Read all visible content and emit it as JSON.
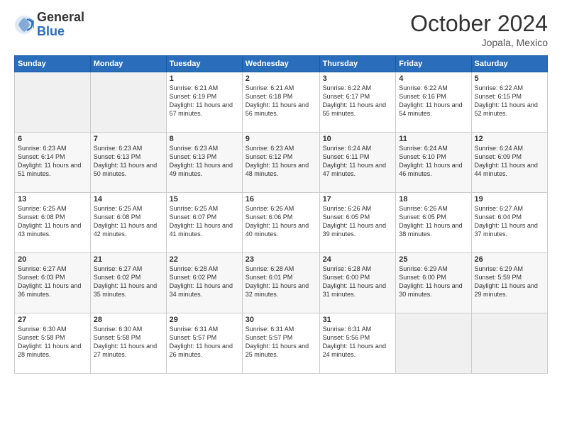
{
  "logo": {
    "general": "General",
    "blue": "Blue"
  },
  "title": "October 2024",
  "location": "Jopala, Mexico",
  "days_of_week": [
    "Sunday",
    "Monday",
    "Tuesday",
    "Wednesday",
    "Thursday",
    "Friday",
    "Saturday"
  ],
  "weeks": [
    [
      {
        "day": "",
        "info": ""
      },
      {
        "day": "",
        "info": ""
      },
      {
        "day": "1",
        "info": "Sunrise: 6:21 AM\nSunset: 6:19 PM\nDaylight: 11 hours and 57 minutes."
      },
      {
        "day": "2",
        "info": "Sunrise: 6:21 AM\nSunset: 6:18 PM\nDaylight: 11 hours and 56 minutes."
      },
      {
        "day": "3",
        "info": "Sunrise: 6:22 AM\nSunset: 6:17 PM\nDaylight: 11 hours and 55 minutes."
      },
      {
        "day": "4",
        "info": "Sunrise: 6:22 AM\nSunset: 6:16 PM\nDaylight: 11 hours and 54 minutes."
      },
      {
        "day": "5",
        "info": "Sunrise: 6:22 AM\nSunset: 6:15 PM\nDaylight: 11 hours and 52 minutes."
      }
    ],
    [
      {
        "day": "6",
        "info": "Sunrise: 6:23 AM\nSunset: 6:14 PM\nDaylight: 11 hours and 51 minutes."
      },
      {
        "day": "7",
        "info": "Sunrise: 6:23 AM\nSunset: 6:13 PM\nDaylight: 11 hours and 50 minutes."
      },
      {
        "day": "8",
        "info": "Sunrise: 6:23 AM\nSunset: 6:13 PM\nDaylight: 11 hours and 49 minutes."
      },
      {
        "day": "9",
        "info": "Sunrise: 6:23 AM\nSunset: 6:12 PM\nDaylight: 11 hours and 48 minutes."
      },
      {
        "day": "10",
        "info": "Sunrise: 6:24 AM\nSunset: 6:11 PM\nDaylight: 11 hours and 47 minutes."
      },
      {
        "day": "11",
        "info": "Sunrise: 6:24 AM\nSunset: 6:10 PM\nDaylight: 11 hours and 46 minutes."
      },
      {
        "day": "12",
        "info": "Sunrise: 6:24 AM\nSunset: 6:09 PM\nDaylight: 11 hours and 44 minutes."
      }
    ],
    [
      {
        "day": "13",
        "info": "Sunrise: 6:25 AM\nSunset: 6:08 PM\nDaylight: 11 hours and 43 minutes."
      },
      {
        "day": "14",
        "info": "Sunrise: 6:25 AM\nSunset: 6:08 PM\nDaylight: 11 hours and 42 minutes."
      },
      {
        "day": "15",
        "info": "Sunrise: 6:25 AM\nSunset: 6:07 PM\nDaylight: 11 hours and 41 minutes."
      },
      {
        "day": "16",
        "info": "Sunrise: 6:26 AM\nSunset: 6:06 PM\nDaylight: 11 hours and 40 minutes."
      },
      {
        "day": "17",
        "info": "Sunrise: 6:26 AM\nSunset: 6:05 PM\nDaylight: 11 hours and 39 minutes."
      },
      {
        "day": "18",
        "info": "Sunrise: 6:26 AM\nSunset: 6:05 PM\nDaylight: 11 hours and 38 minutes."
      },
      {
        "day": "19",
        "info": "Sunrise: 6:27 AM\nSunset: 6:04 PM\nDaylight: 11 hours and 37 minutes."
      }
    ],
    [
      {
        "day": "20",
        "info": "Sunrise: 6:27 AM\nSunset: 6:03 PM\nDaylight: 11 hours and 36 minutes."
      },
      {
        "day": "21",
        "info": "Sunrise: 6:27 AM\nSunset: 6:02 PM\nDaylight: 11 hours and 35 minutes."
      },
      {
        "day": "22",
        "info": "Sunrise: 6:28 AM\nSunset: 6:02 PM\nDaylight: 11 hours and 34 minutes."
      },
      {
        "day": "23",
        "info": "Sunrise: 6:28 AM\nSunset: 6:01 PM\nDaylight: 11 hours and 32 minutes."
      },
      {
        "day": "24",
        "info": "Sunrise: 6:28 AM\nSunset: 6:00 PM\nDaylight: 11 hours and 31 minutes."
      },
      {
        "day": "25",
        "info": "Sunrise: 6:29 AM\nSunset: 6:00 PM\nDaylight: 11 hours and 30 minutes."
      },
      {
        "day": "26",
        "info": "Sunrise: 6:29 AM\nSunset: 5:59 PM\nDaylight: 11 hours and 29 minutes."
      }
    ],
    [
      {
        "day": "27",
        "info": "Sunrise: 6:30 AM\nSunset: 5:58 PM\nDaylight: 11 hours and 28 minutes."
      },
      {
        "day": "28",
        "info": "Sunrise: 6:30 AM\nSunset: 5:58 PM\nDaylight: 11 hours and 27 minutes."
      },
      {
        "day": "29",
        "info": "Sunrise: 6:31 AM\nSunset: 5:57 PM\nDaylight: 11 hours and 26 minutes."
      },
      {
        "day": "30",
        "info": "Sunrise: 6:31 AM\nSunset: 5:57 PM\nDaylight: 11 hours and 25 minutes."
      },
      {
        "day": "31",
        "info": "Sunrise: 6:31 AM\nSunset: 5:56 PM\nDaylight: 11 hours and 24 minutes."
      },
      {
        "day": "",
        "info": ""
      },
      {
        "day": "",
        "info": ""
      }
    ]
  ]
}
